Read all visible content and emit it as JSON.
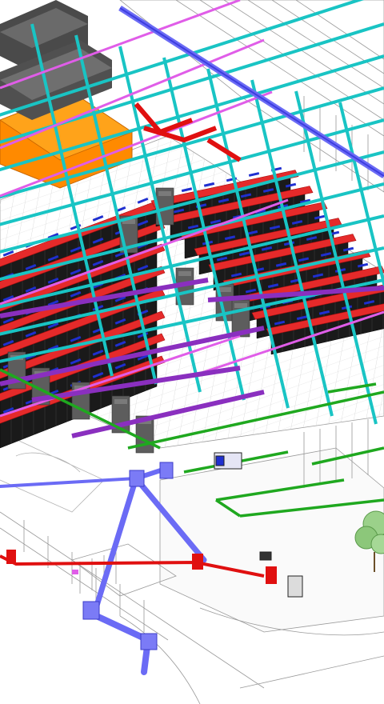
{
  "scene": {
    "kind": "isometric-bim-model",
    "systems": [
      {
        "id": "server-racks",
        "color": "#1a1a1a"
      },
      {
        "id": "hot-aisle-containment",
        "color": "#e52a2a"
      },
      {
        "id": "cold-aisle-trays",
        "color": "#1f2fd0"
      },
      {
        "id": "cable-tray-cyan",
        "color": "#19c4c4"
      },
      {
        "id": "cable-tray-magenta",
        "color": "#e05de8"
      },
      {
        "id": "busway-purple",
        "color": "#8a2fbf"
      },
      {
        "id": "floor-pipe-green",
        "color": "#1fa81f"
      },
      {
        "id": "utility-block-orange",
        "color": "#ff8a00"
      },
      {
        "id": "crac-units-grey",
        "color": "#5d5d5d"
      },
      {
        "id": "outdoor-duct-blue",
        "color": "#6b6bf5"
      },
      {
        "id": "outdoor-pipe-red",
        "color": "#e01010"
      },
      {
        "id": "tree",
        "color": "#7bbf6b"
      }
    ]
  }
}
